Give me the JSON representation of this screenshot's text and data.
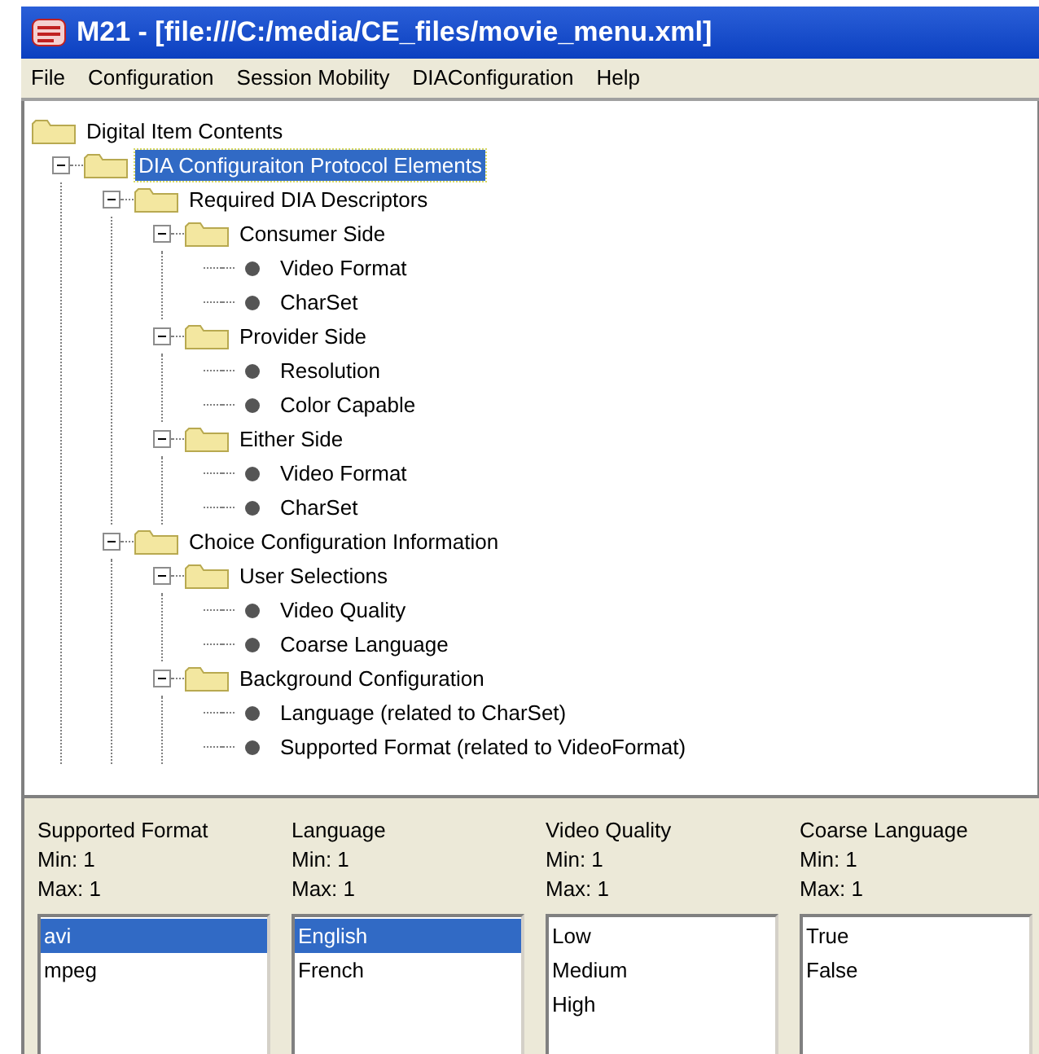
{
  "window": {
    "title": "M21 - [file:///C:/media/CE_files/movie_menu.xml]"
  },
  "menu": [
    "File",
    "Configuration",
    "Session Mobility",
    "DIAConfiguration",
    "Help"
  ],
  "tree": {
    "label": "Digital Item Contents",
    "kind": "folder",
    "selected": false,
    "children": [
      {
        "label": "DIA Configuraiton Protocol Elements",
        "kind": "folder",
        "expanded": true,
        "selected": true,
        "children": [
          {
            "label": "Required DIA Descriptors",
            "kind": "folder",
            "expanded": true,
            "selected": false,
            "children": [
              {
                "label": "Consumer Side",
                "kind": "folder",
                "expanded": true,
                "selected": false,
                "children": [
                  {
                    "label": "Video Format",
                    "kind": "leaf",
                    "selected": false
                  },
                  {
                    "label": "CharSet",
                    "kind": "leaf",
                    "selected": false
                  }
                ]
              },
              {
                "label": "Provider Side",
                "kind": "folder",
                "expanded": true,
                "selected": false,
                "children": [
                  {
                    "label": "Resolution",
                    "kind": "leaf",
                    "selected": false
                  },
                  {
                    "label": "Color Capable",
                    "kind": "leaf",
                    "selected": false
                  }
                ]
              },
              {
                "label": "Either Side",
                "kind": "folder",
                "expanded": true,
                "selected": false,
                "children": [
                  {
                    "label": "Video Format",
                    "kind": "leaf",
                    "selected": false
                  },
                  {
                    "label": "CharSet",
                    "kind": "leaf",
                    "selected": false
                  }
                ]
              }
            ]
          },
          {
            "label": "Choice Configuration Information",
            "kind": "folder",
            "expanded": true,
            "selected": false,
            "children": [
              {
                "label": "User Selections",
                "kind": "folder",
                "expanded": true,
                "selected": false,
                "children": [
                  {
                    "label": "Video Quality",
                    "kind": "leaf",
                    "selected": false
                  },
                  {
                    "label": "Coarse Language",
                    "kind": "leaf",
                    "selected": false
                  }
                ]
              },
              {
                "label": "Background Configuration",
                "kind": "folder",
                "expanded": true,
                "selected": false,
                "children": [
                  {
                    "label": "Language (related to CharSet)",
                    "kind": "leaf",
                    "selected": false
                  },
                  {
                    "label": "Supported Format (related to VideoFormat)",
                    "kind": "leaf",
                    "selected": false
                  }
                ]
              }
            ]
          }
        ]
      }
    ]
  },
  "choices": [
    {
      "title": "Supported Format",
      "min": "Min: 1",
      "max": "Max: 1",
      "options": [
        {
          "label": "avi",
          "selected": true
        },
        {
          "label": "mpeg",
          "selected": false
        }
      ]
    },
    {
      "title": "Language",
      "min": "Min: 1",
      "max": "Max: 1",
      "options": [
        {
          "label": "English",
          "selected": true
        },
        {
          "label": "French",
          "selected": false
        }
      ]
    },
    {
      "title": "Video Quality",
      "min": "Min: 1",
      "max": "Max: 1",
      "options": [
        {
          "label": "Low",
          "selected": false
        },
        {
          "label": "Medium",
          "selected": false
        },
        {
          "label": "High",
          "selected": false
        }
      ]
    },
    {
      "title": "Coarse Language",
      "min": "Min: 1",
      "max": "Max: 1",
      "options": [
        {
          "label": "True",
          "selected": false
        },
        {
          "label": "False",
          "selected": false
        }
      ]
    }
  ]
}
